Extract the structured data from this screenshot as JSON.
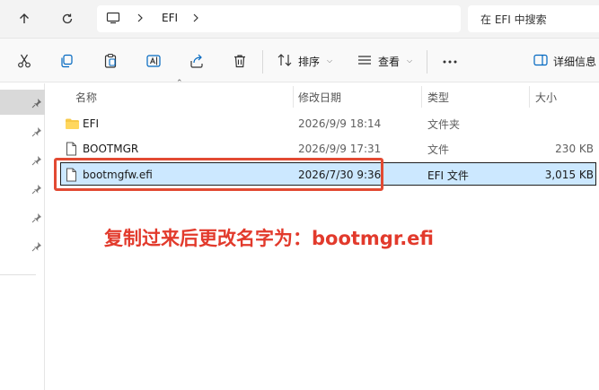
{
  "address_bar": {
    "breadcrumbs": [
      "EFI"
    ],
    "search_placeholder": "在 EFI 中搜索"
  },
  "toolbar": {
    "sort_label": "排序",
    "view_label": "查看",
    "details_label": "详细信息"
  },
  "file_list": {
    "columns": {
      "name": "名称",
      "modified": "修改日期",
      "type": "类型",
      "size": "大小"
    },
    "rows": [
      {
        "name": "EFI",
        "modified": "2026/9/9 18:14",
        "type": "文件夹",
        "size": "",
        "icon": "folder-icon"
      },
      {
        "name": "BOOTMGR",
        "modified": "2026/9/9 17:31",
        "type": "文件",
        "size": "230 KB",
        "icon": "file-icon"
      },
      {
        "name": "bootmgfw.efi",
        "modified": "2026/7/30 9:36",
        "type": "EFI 文件",
        "size": "3,015 KB",
        "icon": "file-icon",
        "selected": true
      }
    ]
  },
  "annotation": {
    "text": "复制过来后更改名字为：bootmgr.efi",
    "color": "#e23a2c"
  },
  "colors": {
    "selection_bg": "#cce8ff",
    "folder": "#f7c948",
    "accent": "#0067c0"
  }
}
